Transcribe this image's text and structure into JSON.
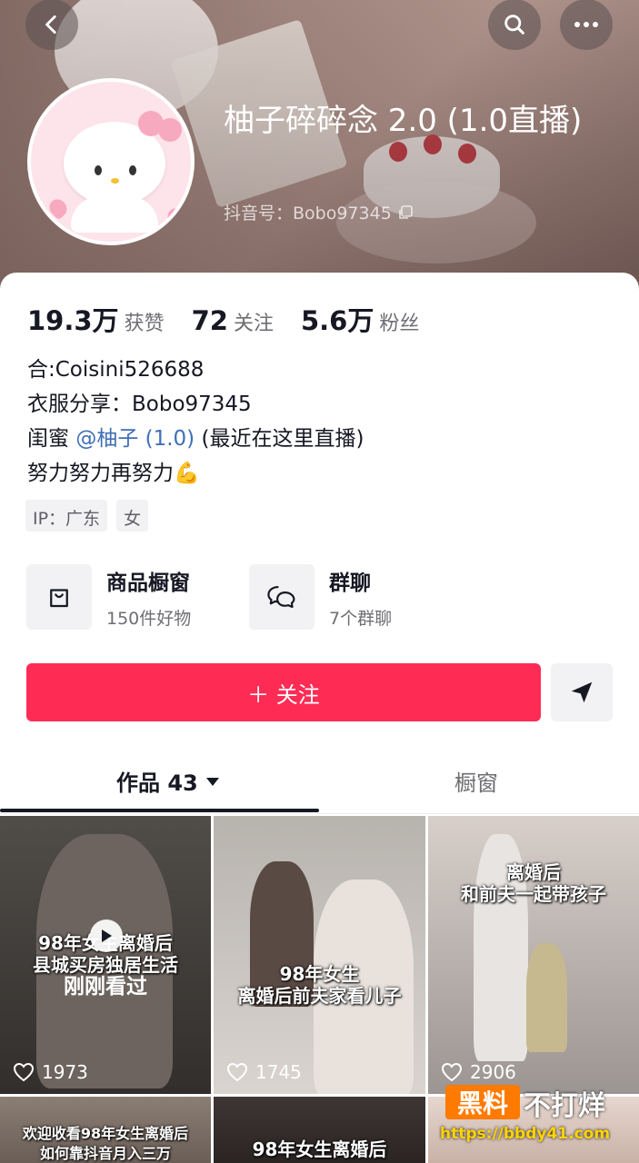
{
  "header": {
    "back_icon": "chevron-left-icon",
    "search_icon": "search-icon",
    "more_icon": "more-icon",
    "title": "柚子碎碎念 2.0 (1.0直播)",
    "uid_label": "抖音号：Bobo97345",
    "copy_icon": "copy-icon"
  },
  "stats": [
    {
      "num": "19.3万",
      "label": "获赞"
    },
    {
      "num": "72",
      "label": "关注"
    },
    {
      "num": "5.6万",
      "label": "粉丝"
    }
  ],
  "bio": {
    "line1": "合:Coisini526688",
    "line2": "衣服分享：Bobo97345",
    "line3_prefix": "闺蜜 ",
    "line3_mention": "@柚子 (1.0)",
    "line3_suffix": " (最近在这里直播)",
    "line4": "努力努力再努力💪"
  },
  "tags": [
    "IP：广东",
    "女"
  ],
  "quick": {
    "shop_title": "商品橱窗",
    "shop_sub": "150件好物",
    "group_title": "群聊",
    "group_sub": "7个群聊"
  },
  "actions": {
    "follow_label": "＋ 关注",
    "share_icon": "send-icon"
  },
  "tabs": {
    "works_label": "作品 43",
    "showcase_label": "橱窗"
  },
  "videos": [
    {
      "caption": "98年女生离婚后\n县城买房独居生活",
      "likes": "1973",
      "status": "刚刚看过"
    },
    {
      "caption": "98年女生\n离婚后前夫家看儿子",
      "likes": "1745"
    },
    {
      "caption": "离婚后\n和前夫一起带孩子",
      "likes": "2906"
    },
    {
      "caption": "欢迎收看98年女生离婚后\n如何靠抖音月入三万",
      "likes": ""
    },
    {
      "caption": "98年女生离婚后",
      "likes": ""
    }
  ],
  "watermark": {
    "brand_a": "黑料",
    "brand_b": "不打烊",
    "url": "https://bbdy41.com"
  },
  "colors": {
    "accent": "#fe2c55",
    "mention": "#3f6fb6",
    "text": "#161823",
    "muted": "#6e6e73"
  }
}
